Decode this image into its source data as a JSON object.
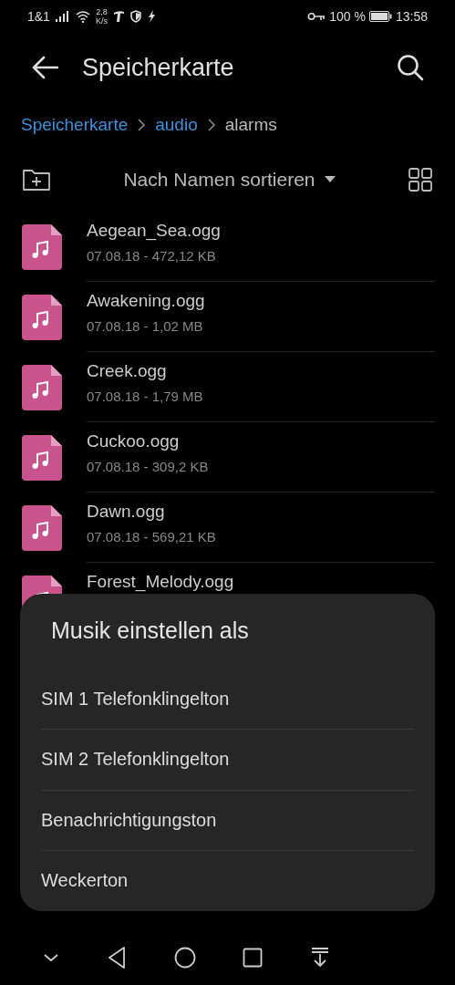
{
  "status_bar": {
    "carrier": "1&1",
    "speed_value": "2,8",
    "speed_unit": "K/s",
    "battery": "100 %",
    "time": "13:58"
  },
  "header": {
    "title": "Speicherkarte"
  },
  "breadcrumb": [
    {
      "label": "Speicherkarte",
      "selected": false
    },
    {
      "label": "audio",
      "selected": false
    },
    {
      "label": "alarms",
      "selected": true
    }
  ],
  "sort": {
    "label": "Nach Namen sortieren"
  },
  "files": [
    {
      "name": "Aegean_Sea.ogg",
      "meta": "07.08.18 - 472,12 KB"
    },
    {
      "name": "Awakening.ogg",
      "meta": "07.08.18 - 1,02 MB"
    },
    {
      "name": "Creek.ogg",
      "meta": "07.08.18 - 1,79 MB"
    },
    {
      "name": "Cuckoo.ogg",
      "meta": "07.08.18 - 309,2 KB"
    },
    {
      "name": "Dawn.ogg",
      "meta": "07.08.18 - 569,21 KB"
    },
    {
      "name": "Forest_Melody.ogg"
    }
  ],
  "sheet": {
    "title": "Musik einstellen als",
    "options": [
      "SIM 1 Telefonklingelton",
      "SIM 2 Telefonklingelton",
      "Benachrichtigungston",
      "Weckerton"
    ]
  }
}
